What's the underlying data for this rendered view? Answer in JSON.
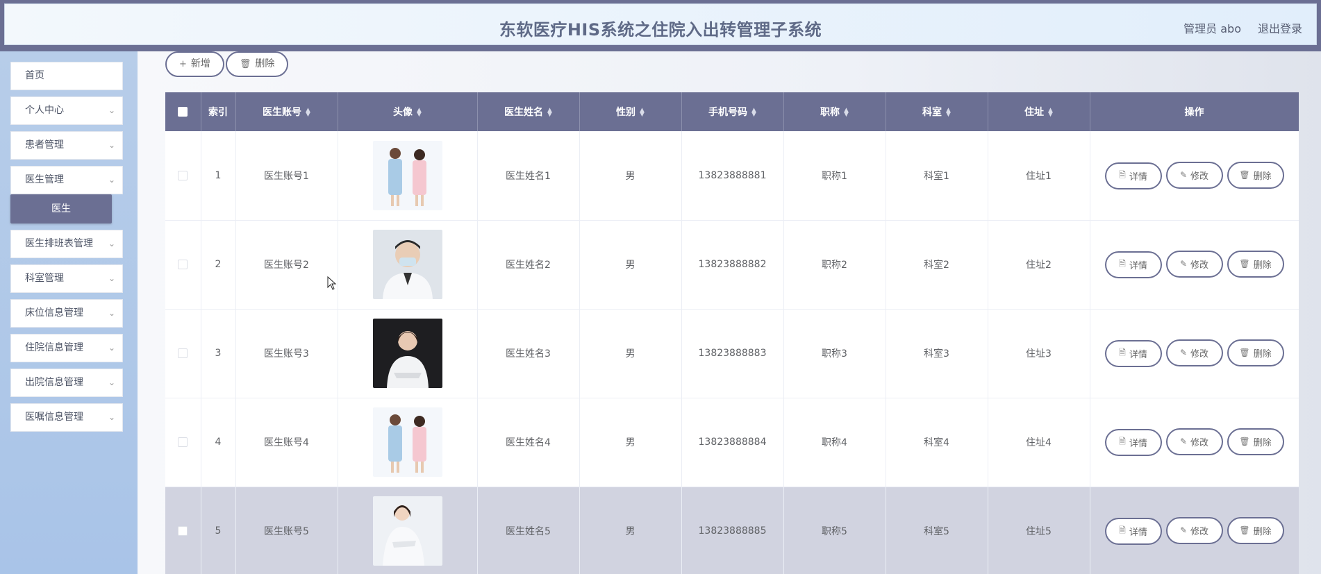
{
  "header": {
    "title": "东软医疗HIS系统之住院入出转管理子系统",
    "user_label": "管理员 abo",
    "logout_label": "退出登录"
  },
  "sidebar": {
    "items": [
      {
        "label": "首页",
        "has_chevron": false
      },
      {
        "label": "个人中心",
        "has_chevron": true
      },
      {
        "label": "患者管理",
        "has_chevron": true
      },
      {
        "label": "医生管理",
        "has_chevron": true
      },
      {
        "label": "医生排班表管理",
        "has_chevron": true
      },
      {
        "label": "科室管理",
        "has_chevron": true
      },
      {
        "label": "床位信息管理",
        "has_chevron": true
      },
      {
        "label": "住院信息管理",
        "has_chevron": true
      },
      {
        "label": "出院信息管理",
        "has_chevron": true
      },
      {
        "label": "医嘱信息管理",
        "has_chevron": true
      }
    ],
    "active_submenu": "医生"
  },
  "toolbar": {
    "add_label": "新增",
    "delete_label": "删除"
  },
  "table": {
    "columns": [
      "",
      "索引",
      "医生账号",
      "头像",
      "医生姓名",
      "性别",
      "手机号码",
      "职称",
      "科室",
      "住址",
      "操作"
    ],
    "rows": [
      {
        "index": "1",
        "account": "医生账号1",
        "name": "医生姓名1",
        "gender": "男",
        "phone": "13823888881",
        "title": "职称1",
        "dept": "科室1",
        "address": "住址1"
      },
      {
        "index": "2",
        "account": "医生账号2",
        "name": "医生姓名2",
        "gender": "男",
        "phone": "13823888882",
        "title": "职称2",
        "dept": "科室2",
        "address": "住址2"
      },
      {
        "index": "3",
        "account": "医生账号3",
        "name": "医生姓名3",
        "gender": "男",
        "phone": "13823888883",
        "title": "职称3",
        "dept": "科室3",
        "address": "住址3"
      },
      {
        "index": "4",
        "account": "医生账号4",
        "name": "医生姓名4",
        "gender": "男",
        "phone": "13823888884",
        "title": "职称4",
        "dept": "科室4",
        "address": "住址4"
      },
      {
        "index": "5",
        "account": "医生账号5",
        "name": "医生姓名5",
        "gender": "男",
        "phone": "13823888885",
        "title": "职称5",
        "dept": "科室5",
        "address": "住址5"
      }
    ],
    "actions": {
      "detail_label": "详情",
      "edit_label": "修改",
      "delete_label": "删除"
    }
  },
  "colors": {
    "accent": "#6b6f93",
    "sidebar_bg": "#b7cde9",
    "selected_row": "#d1d3e0"
  }
}
